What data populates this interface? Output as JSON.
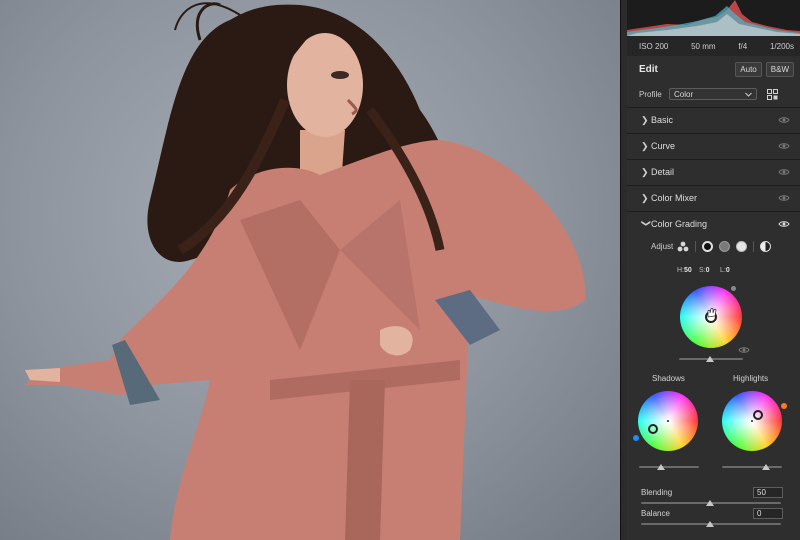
{
  "exif": {
    "iso": "ISO 200",
    "focal_length": "50 mm",
    "aperture": "f/4",
    "shutter": "1/200s"
  },
  "edit": {
    "title": "Edit",
    "auto_label": "Auto",
    "bw_label": "B&W",
    "profile_label": "Profile",
    "profile_value": "Color"
  },
  "sections": [
    {
      "title": "Basic",
      "expanded": false
    },
    {
      "title": "Curve",
      "expanded": false
    },
    {
      "title": "Detail",
      "expanded": false
    },
    {
      "title": "Color Mixer",
      "expanded": false
    },
    {
      "title": "Color Grading",
      "expanded": true
    }
  ],
  "color_grading": {
    "adjust_label": "Adjust",
    "hsl": {
      "h_label": "H:",
      "h_value": "50",
      "s_label": "S:",
      "s_value": "0",
      "l_label": "L:",
      "l_value": "0"
    },
    "shadows_label": "Shadows",
    "highlights_label": "Highlights",
    "blending_label": "Blending",
    "blending_value": "50",
    "balance_label": "Balance",
    "balance_value": "0"
  },
  "colors": {
    "panel_bg": "#2e2e2e",
    "shadow_dot": "#1e8cff",
    "highlight_dot": "#ff7a1a",
    "coat": "#c77f74"
  },
  "icons": [
    "chevron-right-icon",
    "chevron-down-icon",
    "eye-icon",
    "profile-browser-icon",
    "hand-cursor-icon"
  ]
}
